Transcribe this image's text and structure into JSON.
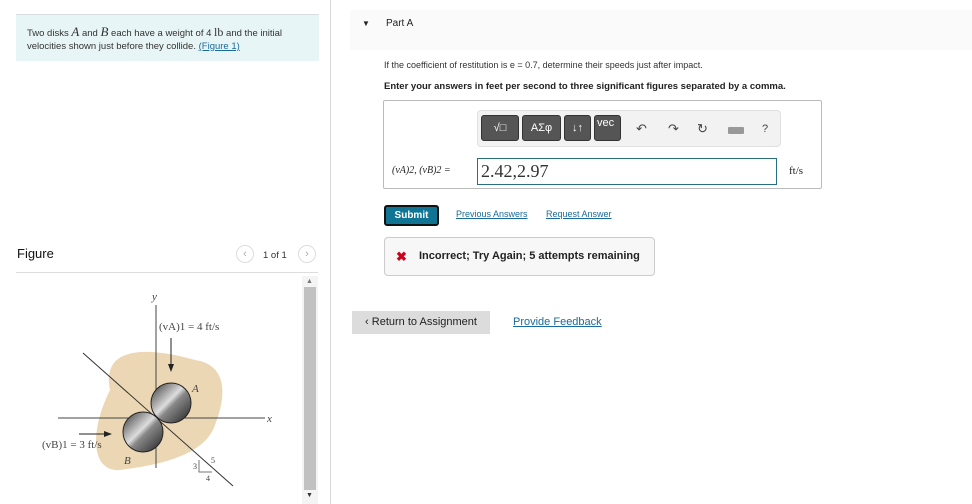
{
  "problem": {
    "text_1": "Two disks ",
    "var_a": "A",
    "text_2": " and ",
    "var_b": "B",
    "text_3": " each have a weight of 4 ",
    "unit": "lb",
    "text_4": " and the initial velocities shown just before they collide. ",
    "figure_link": "(Figure 1)"
  },
  "figure": {
    "title": "Figure",
    "pager": "1 of 1",
    "label_y": "y",
    "label_x": "x",
    "label_va": "(vA)1 = 4 ft/s",
    "label_vb": "(vB)1 = 3 ft/s",
    "label_a": "A",
    "label_b": "B",
    "slope_3": "3",
    "slope_4": "4",
    "slope_5": "5",
    "blob_color": "#ecd7b4"
  },
  "part": {
    "title": "Part A",
    "question": "If the coefficient of restitution is e = 0.7, determine their speeds just after impact.",
    "instruction": "Enter your answers in feet per second to three significant figures separated by a comma.",
    "toolbar": [
      "√□",
      "ΑΣφ",
      "↓↑",
      "vec"
    ],
    "answer_label": "(vA)2, (vB)2 =",
    "answer_value": "2.42,2.97",
    "answer_unit": "ft/s",
    "submit": "Submit",
    "previous_answers": "Previous Answers",
    "request_answer": "Request Answer",
    "feedback": "Incorrect; Try Again; 5 attempts remaining",
    "help": "?"
  },
  "footer": {
    "return": "Return to Assignment",
    "provide_feedback": "Provide Feedback"
  },
  "colors": {
    "accent": "#107595",
    "error": "#d0021b",
    "link": "#1a6b9a"
  }
}
